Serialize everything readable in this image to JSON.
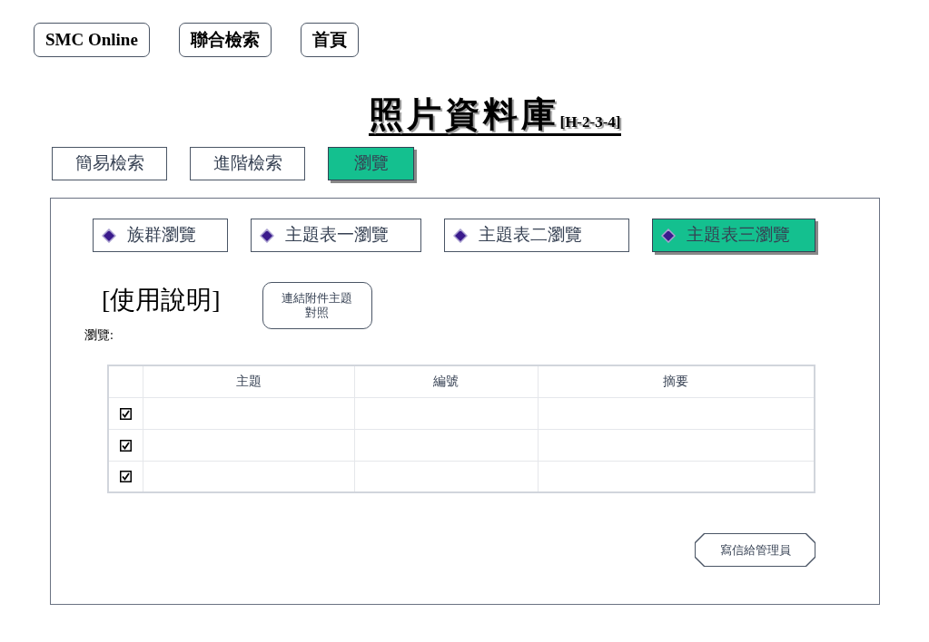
{
  "top_nav": [
    "SMC Online",
    "聯合檢索",
    "首頁"
  ],
  "title": {
    "main": "照片資料庫",
    "code": "[H-2-3-4]"
  },
  "search_tabs": [
    {
      "label": "簡易檢索",
      "selected": false
    },
    {
      "label": "進階檢索",
      "selected": false
    },
    {
      "label": "瀏覽",
      "selected": true
    }
  ],
  "browse_tabs": [
    {
      "label": "族群瀏覽",
      "selected": false
    },
    {
      "label": "主題表一瀏覽",
      "selected": false
    },
    {
      "label": "主題表二瀏覽",
      "selected": false
    },
    {
      "label": "主題表三瀏覽",
      "selected": true
    }
  ],
  "help_link": "[使用說明]",
  "attachment_button": "連結附件主題對照",
  "browse_label": "瀏覽:",
  "table": {
    "columns": [
      "主題",
      "編號",
      "摘要"
    ],
    "rows": [
      {
        "checked": true
      },
      {
        "checked": true
      },
      {
        "checked": true
      }
    ]
  },
  "mail_button": "寫信給管理員"
}
